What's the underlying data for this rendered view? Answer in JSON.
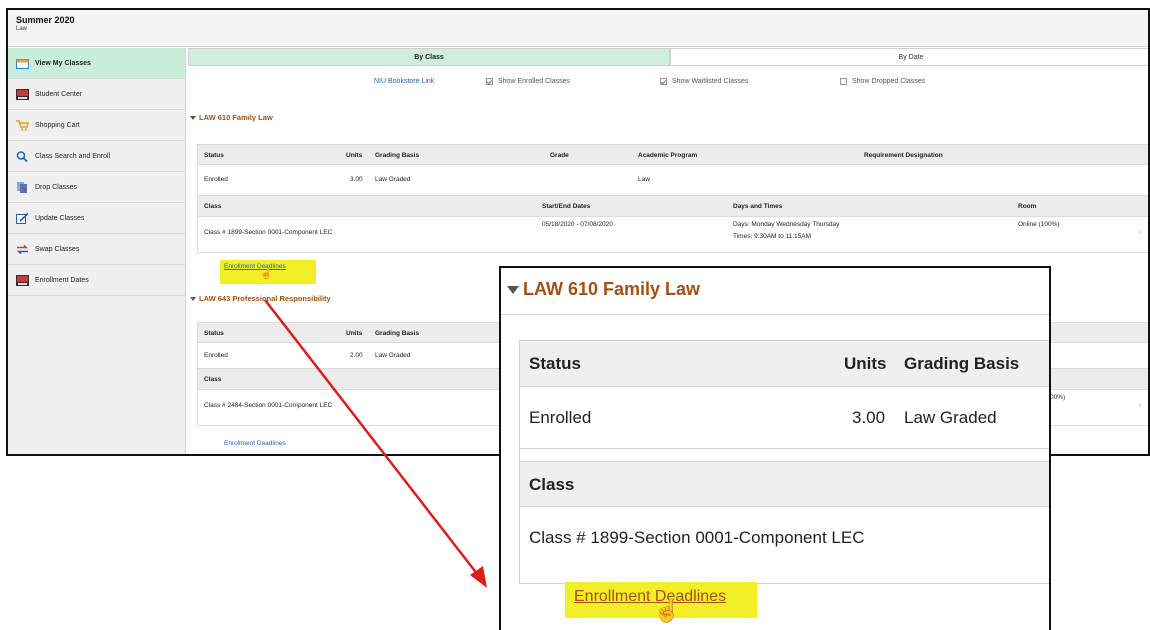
{
  "term": {
    "title": "Summer 2020",
    "subtitle": "Law"
  },
  "sidebar": {
    "items": [
      {
        "label": "View My Classes",
        "icon": "calendar-icon",
        "active": true
      },
      {
        "label": "Student Center",
        "icon": "student-center-icon",
        "active": false
      },
      {
        "label": "Shopping Cart",
        "icon": "shopping-cart-icon",
        "active": false
      },
      {
        "label": "Class Search and Enroll",
        "icon": "search-icon",
        "active": false
      },
      {
        "label": "Drop Classes",
        "icon": "drop-classes-icon",
        "active": false
      },
      {
        "label": "Update Classes",
        "icon": "edit-icon",
        "active": false
      },
      {
        "label": "Swap Classes",
        "icon": "swap-icon",
        "active": false
      },
      {
        "label": "Enrollment Dates",
        "icon": "calendar-dates-icon",
        "active": false
      }
    ]
  },
  "tabs": {
    "by_class": "By Class",
    "by_date": "By Date"
  },
  "filters": {
    "bookstore": "NIU Bookstore Link",
    "enrolled": "Show Enrolled Classes",
    "waitlisted": "Show Waitlisted Classes",
    "dropped": "Show Dropped Classes"
  },
  "headers": {
    "status": "Status",
    "units": "Units",
    "grading": "Grading Basis",
    "grade": "Grade",
    "program": "Academic Program",
    "requirement": "Requirement Designation",
    "class": "Class",
    "dates": "Start/End Dates",
    "days_times": "Days and Times",
    "room": "Room"
  },
  "courses": [
    {
      "title": "LAW 610 Family Law",
      "status": "Enrolled",
      "units": "3.00",
      "grading": "Law Graded",
      "program": "Law",
      "class": "Class # 1899-Section 0001-Component LEC",
      "dates": "05/18/2020 - 07/08/2020",
      "days": "Days: Monday Wednesday Thursday",
      "times": "Times: 9:30AM to 11:15AM",
      "room": "Online (100%)",
      "deadlines": "Enrollment Deadlines"
    },
    {
      "title": "LAW 643 Professional Responsibility",
      "status": "Enrolled",
      "units": "2.00",
      "grading": "Law Graded",
      "class": "Class # 2484-Section 0001-Component LEC",
      "room_partial": "00%)",
      "deadlines": "Enrollment Deadlines"
    }
  ],
  "zoom": {
    "title": "LAW 610 Family Law",
    "status_header": "Status",
    "units_header": "Units",
    "grading_header": "Grading Basis",
    "status": "Enrolled",
    "units": "3.00",
    "grading": "Law Graded",
    "class_header": "Class",
    "class": "Class # 1899-Section 0001-Component LEC",
    "deadlines": "Enrollment Deadlines"
  },
  "colors": {
    "accent_green": "#c9eedb",
    "course_title": "#a84f10",
    "link_blue": "#2b5fb3",
    "highlight": "#f2ef27",
    "arrow": "#e01b1b"
  }
}
